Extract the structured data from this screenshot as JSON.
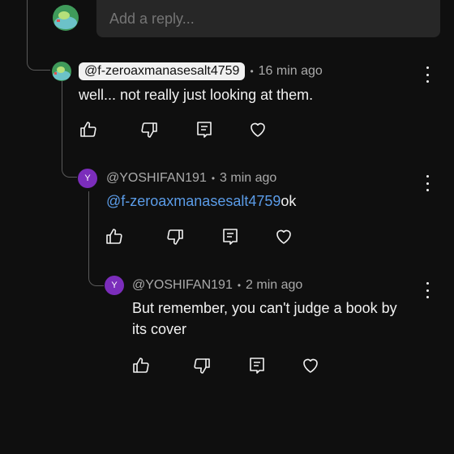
{
  "reply_input": {
    "placeholder": "Add a reply..."
  },
  "comments": [
    {
      "handle": "@f-zeroaxmanasesalt4759",
      "time": "16 min ago",
      "text": "well... not really just looking at them."
    },
    {
      "avatar_letter": "Y",
      "handle": "@YOSHIFAN191",
      "time": "3 min ago",
      "mention": "@f-zeroaxmanasesalt4759",
      "text": "ok"
    },
    {
      "avatar_letter": "Y",
      "handle": "@YOSHIFAN191",
      "time": "2 min ago",
      "text_line1": "But remember, you can't judge a book by",
      "text_line2": "its cover"
    }
  ],
  "separator": "•",
  "icons": [
    "like-icon",
    "dislike-icon",
    "reply-icon",
    "heart-icon",
    "more-vert-icon"
  ],
  "colors": {
    "background": "#0f0f0f",
    "mention": "#5b9ce8",
    "avatar_purple": "#7b2dbb",
    "input_bg": "#272727"
  }
}
